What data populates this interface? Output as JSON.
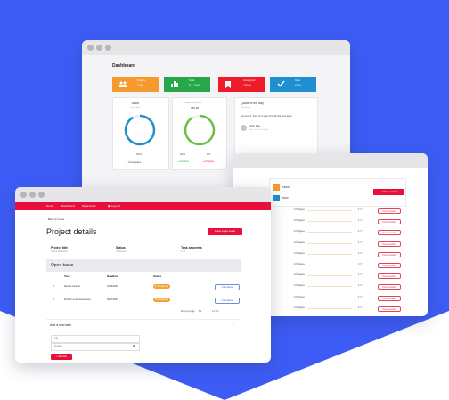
{
  "dashboard": {
    "title": "Dashboard",
    "stats": [
      {
        "label": "Projects",
        "value": "12%",
        "color": "#f49a2e"
      },
      {
        "label": "Tasks",
        "value": "$ 1.34K",
        "color": "#27a64a"
      },
      {
        "label": "Unassigned",
        "value": "180%",
        "color": "#ef1b2a"
      },
      {
        "label": "Done",
        "value": "87%",
        "color": "#1f8fd0"
      }
    ],
    "tasks_card": {
      "title": "Tasks",
      "subtitle": "this month",
      "percent": "92%",
      "legend": "Completed",
      "progress": 0.92,
      "color": "#1f8fd0"
    },
    "projects_card": {
      "title": "Projects this month",
      "value": "382.26",
      "left_pct": "92%",
      "right_pct": "8%",
      "legend_left": "Finished",
      "legend_right": "Ongoing",
      "progress": 0.92,
      "color": "#6cc04a"
    },
    "quote_card": {
      "title": "Quote of the day",
      "subtitle": "Best Quote",
      "text": "Remember: there is no easy formula that wins daily!",
      "author": "John Doe",
      "author_sub": "Team lead, Tech Dept"
    }
  },
  "middle": {
    "stat1_value": "1582K",
    "stat2_value": "6526",
    "add_button": "+ Add new project",
    "rows": [
      {
        "status": "In Progress",
        "count": "2 / 7",
        "action": "View details"
      },
      {
        "status": "In Progress",
        "count": "2 / 7",
        "action": "View details"
      },
      {
        "status": "In Progress",
        "count": "2 / 7",
        "action": "View details"
      },
      {
        "status": "In Progress",
        "count": "3 / 7",
        "action": "View details"
      },
      {
        "status": "In Progress",
        "count": "2 / 7",
        "action": "View details"
      },
      {
        "status": "In Progress",
        "count": "3 / 7",
        "action": "View details"
      },
      {
        "status": "In Progress",
        "count": "2 / 7",
        "action": "View details"
      },
      {
        "status": "In Progress",
        "count": "2 / 7",
        "action": "View details"
      },
      {
        "status": "In Progress",
        "count": "3 / 7",
        "action": "View details"
      },
      {
        "status": "In Progress",
        "count": "2 / 7",
        "action": "View details"
      }
    ],
    "row_note": "Marketing plan"
  },
  "front": {
    "nav": [
      "Home",
      "Dashboard",
      "My account",
      "Log out"
    ],
    "back": "← Back to home",
    "title": "Project details",
    "delete_button": "Delete project details",
    "project_title_label": "Project title",
    "project_title_value": "Online Education",
    "status_label": "Status",
    "status_value": "In Progress",
    "progress_label": "Task progress",
    "progress_value": "0 / 2",
    "open_tasks": "Open tasks",
    "columns": [
      "Task",
      "Deadline",
      "Status"
    ],
    "tasks": [
      {
        "task": "Review contract",
        "deadline": "07/26/2023",
        "status": "In Progress",
        "action": "Complete"
      },
      {
        "task": "Perform a risk assessment",
        "deadline": "08/17/2023",
        "status": "In Progress",
        "action": "Complete"
      }
    ],
    "pagination": {
      "rows_label": "Rows per page:",
      "rows_value": "5",
      "range": "1-2 of 2"
    },
    "add_section": "Add a new task",
    "title_placeholder": "Title",
    "deadline_placeholder": "Deadline",
    "add_button": "+ Add task"
  },
  "colors": {
    "background": "#3d5cf5",
    "accent": "#e8103a"
  }
}
